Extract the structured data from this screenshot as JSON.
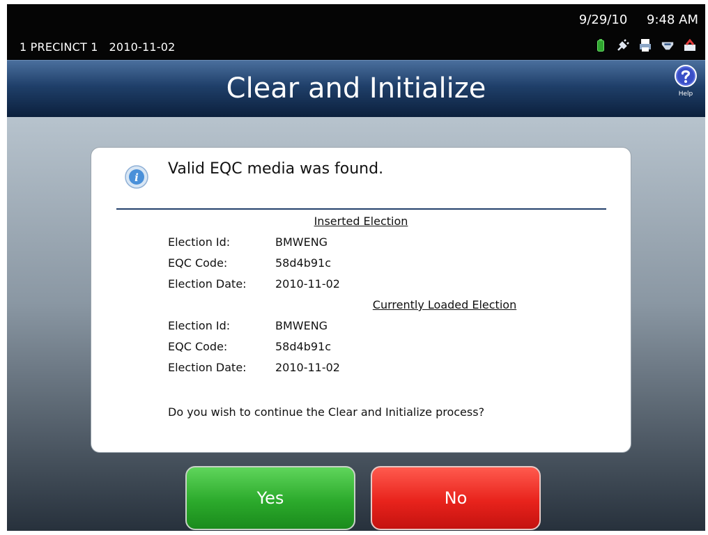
{
  "status": {
    "precinct": "1 PRECINCT 1",
    "election_date": "2010-11-02",
    "date": "9/29/10",
    "time": "9:48 AM",
    "icons": [
      "battery-icon",
      "power-plug-icon",
      "printer-icon",
      "usb-icon",
      "network-icon"
    ]
  },
  "header": {
    "title": "Clear and Initialize",
    "help_label": "Help"
  },
  "dialog": {
    "message": "Valid EQC media was found.",
    "inserted": {
      "heading": "Inserted Election",
      "rows": [
        {
          "label": "Election Id:",
          "value": "BMWENG"
        },
        {
          "label": "EQC Code:",
          "value": "58d4b91c"
        },
        {
          "label": "Election Date:",
          "value": "2010-11-02"
        }
      ]
    },
    "loaded": {
      "heading": "Currently Loaded Election",
      "rows": [
        {
          "label": "Election Id:",
          "value": "BMWENG"
        },
        {
          "label": "EQC Code:",
          "value": "58d4b91c"
        },
        {
          "label": "Election Date:",
          "value": "2010-11-02"
        }
      ]
    },
    "question": "Do you wish to continue the Clear and Initialize process?"
  },
  "buttons": {
    "yes": "Yes",
    "no": "No"
  },
  "colors": {
    "yes_green": "#2caa2c",
    "no_red": "#e8231c",
    "title_blue": "#1f3f69"
  }
}
